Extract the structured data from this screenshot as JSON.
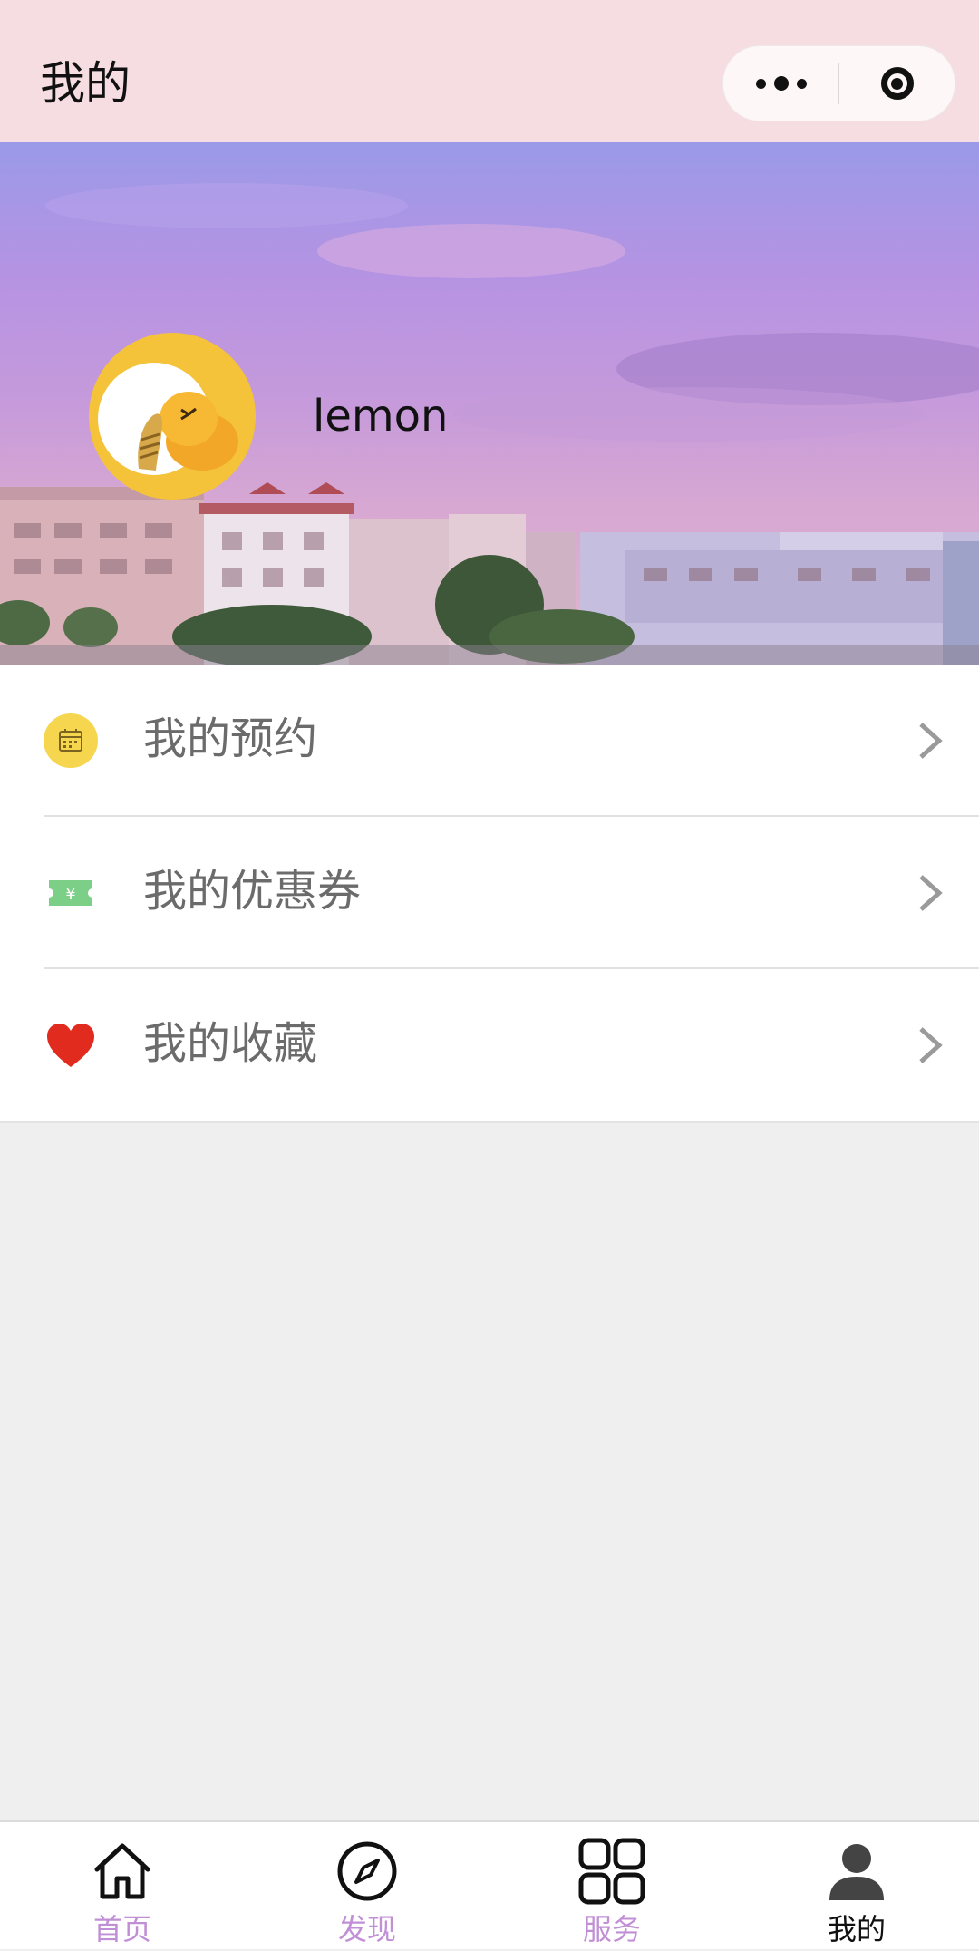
{
  "nav_bar": {
    "title": "我的",
    "more_icon": "more-dots-icon",
    "close_icon": "target-close-icon"
  },
  "profile": {
    "username": "lemon",
    "avatar_icon": "cartoon-avatar-icon"
  },
  "menu": {
    "items": [
      {
        "label": "我的预约",
        "icon": "calendar-icon",
        "color": "#f6d64e"
      },
      {
        "label": "我的优惠券",
        "icon": "coupon-icon",
        "color": "#7ccf86"
      },
      {
        "label": "我的收藏",
        "icon": "heart-icon",
        "color": "#e12b1f"
      }
    ]
  },
  "tabbar": {
    "inactive_color": "#c18fd6",
    "active_color": "#111111",
    "tabs": [
      {
        "label": "首页",
        "icon": "home-icon",
        "active": false
      },
      {
        "label": "发现",
        "icon": "compass-icon",
        "active": false
      },
      {
        "label": "服务",
        "icon": "grid-icon",
        "active": false
      },
      {
        "label": "我的",
        "icon": "user-icon",
        "active": true
      }
    ]
  }
}
